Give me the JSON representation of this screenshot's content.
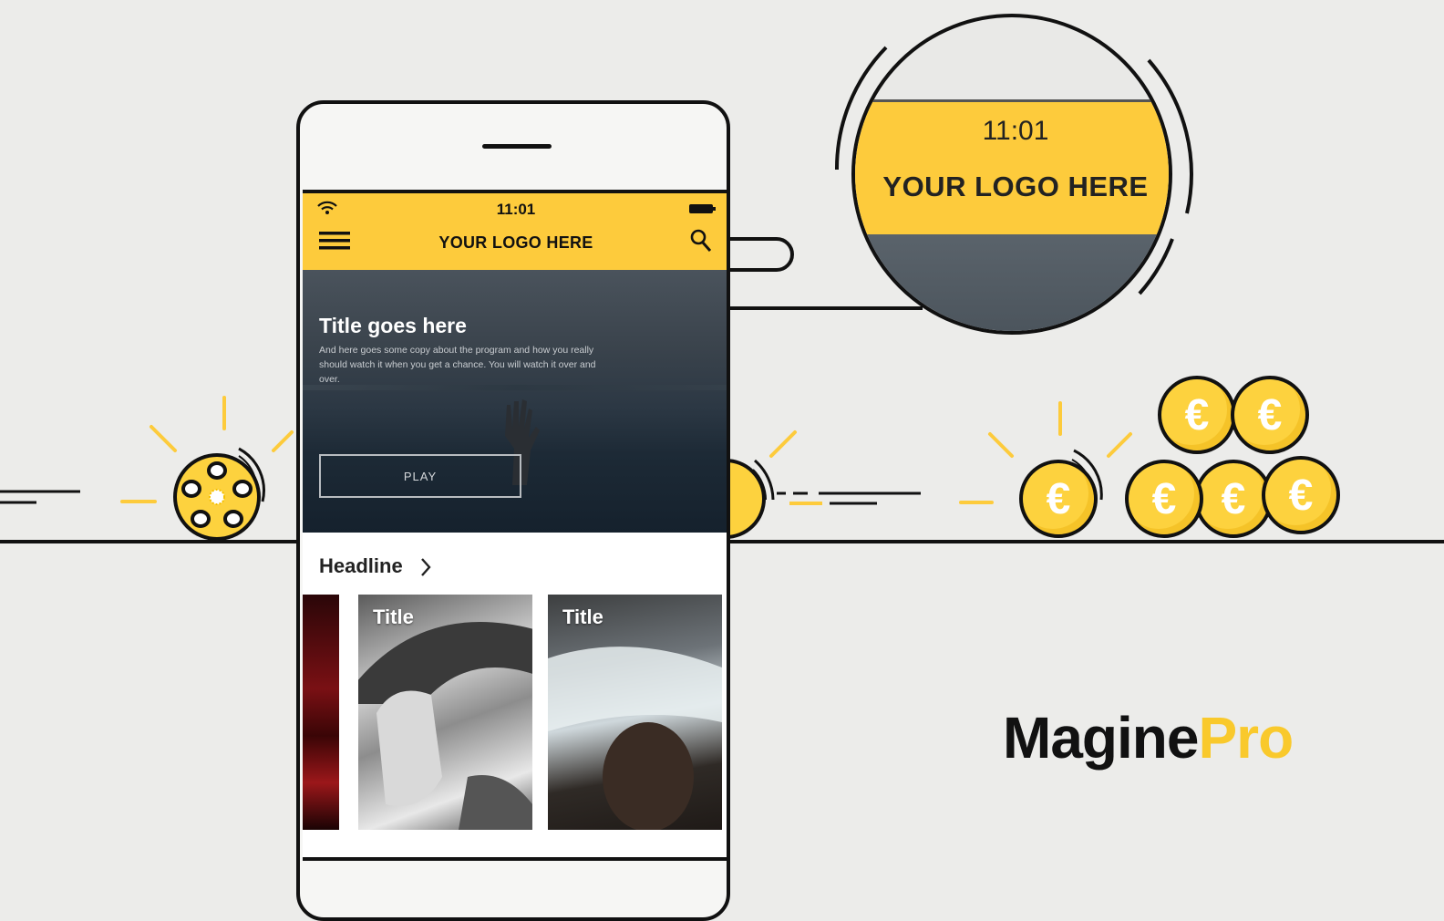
{
  "phone": {
    "status_time": "11:01",
    "logo_text": "YOUR LOGO HERE",
    "hero": {
      "title": "Title goes here",
      "description": "And here goes some copy about the program and how you really should watch it when you get a chance. You will watch it over and over.",
      "play_label": "PLAY"
    },
    "section": {
      "headline": "Headline",
      "cards": [
        {
          "title": ""
        },
        {
          "title": "Title"
        },
        {
          "title": "Title"
        }
      ]
    }
  },
  "magnifier": {
    "time": "11:01",
    "logo_text": "YOUR LOGO HERE"
  },
  "brand": {
    "part1": "Magine",
    "part2": "Pro"
  },
  "coins": {
    "symbol": "€"
  },
  "colors": {
    "accent_yellow": "#fdcb3c",
    "brand_yellow": "#f9c92c",
    "outline": "#111111",
    "background": "#ececea"
  },
  "icons": [
    "wifi-icon",
    "battery-icon",
    "menu-icon",
    "search-icon",
    "chevron-right-icon",
    "film-reel-icon",
    "euro-coin-icon"
  ]
}
